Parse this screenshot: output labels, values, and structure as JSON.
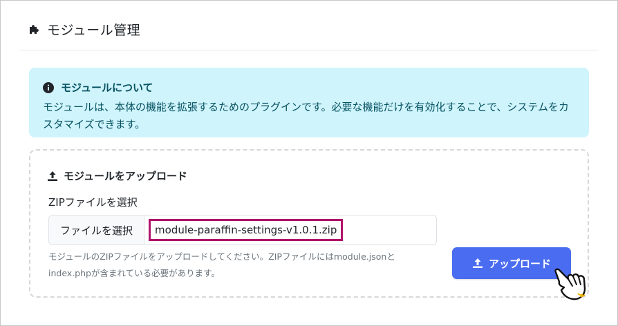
{
  "page": {
    "title": "モジュール管理",
    "title_icon": "puzzle-icon"
  },
  "info": {
    "heading": "モジュールについて",
    "text": "モジュールは、本体の機能を拡張するためのプラグインです。必要な機能だけを有効化することで、システムをカスタマイズできます。",
    "icon": "info-circle-icon"
  },
  "upload": {
    "heading": "モジュールをアップロード",
    "heading_icon": "upload-icon",
    "file_label": "ZIPファイルを選択",
    "choose_button": "ファイルを選択",
    "selected_file": "module-paraffin-settings-v1.0.1.zip",
    "hint": "モジュールのZIPファイルをアップロードしてください。ZIPファイルにはmodule.jsonとindex.phpが含まれている必要があります。",
    "submit_label": "アップロード",
    "submit_icon": "upload-icon"
  },
  "colors": {
    "info_bg": "#cff4fc",
    "info_text": "#055160",
    "primary": "#4a6cf0",
    "highlight": "#b0136a"
  }
}
